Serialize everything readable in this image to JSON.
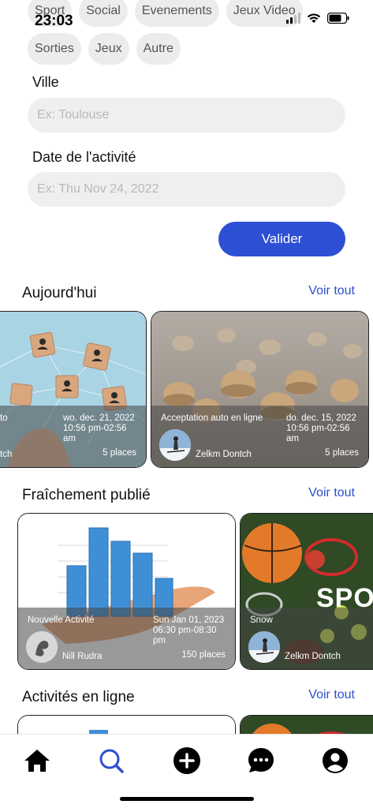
{
  "status_bar": {
    "time": "23:03"
  },
  "categories": {
    "row1": [
      "Sport",
      "Social",
      "Evenements",
      "Jeux Video"
    ],
    "row2": [
      "Sorties",
      "Jeux",
      "Autre"
    ]
  },
  "form": {
    "ville_label": "Ville",
    "ville_placeholder": "Ex: Toulouse",
    "date_label": "Date de l'activité",
    "date_placeholder": "Ex: Thu Nov 24, 2022",
    "submit_label": "Valider"
  },
  "sections": {
    "today": {
      "title": "Aujourd'hui",
      "see_all": "Voir tout",
      "cards": [
        {
          "title": "to",
          "date": "wo. dec. 21, 2022",
          "time": "10:56 pm-02:56",
          "time2": "am",
          "author": "tch",
          "places": "5 places"
        },
        {
          "title": "Acceptation auto en ligne",
          "date": "do. dec. 15, 2022",
          "time": "10:56 pm-02:56",
          "time2": "am",
          "author": "Zelkm Dontch",
          "places": "5 places"
        }
      ]
    },
    "fresh": {
      "title": "Fraîchement publié",
      "see_all": "Voir tout",
      "cards": [
        {
          "title": "Nouvelle Activité",
          "date": "Sun Jan 01, 2023",
          "time": "06:30 pm-08:30",
          "time2": "pm",
          "author": "Nill Rudra",
          "places": "150 places"
        },
        {
          "title": "Snow",
          "author": "Zelkm Dontch",
          "banner_text": "SPO"
        }
      ]
    },
    "online": {
      "title": "Activités en ligne",
      "see_all": "Voir tout"
    }
  },
  "nav": {
    "items": [
      "home-icon",
      "search-icon",
      "add-icon",
      "chat-icon",
      "profile-icon"
    ],
    "active": "search-icon",
    "accent": "#2c4fd4"
  },
  "colors": {
    "accent": "#2c4fd4",
    "chip_bg": "#ececec",
    "input_bg": "#efefef"
  }
}
